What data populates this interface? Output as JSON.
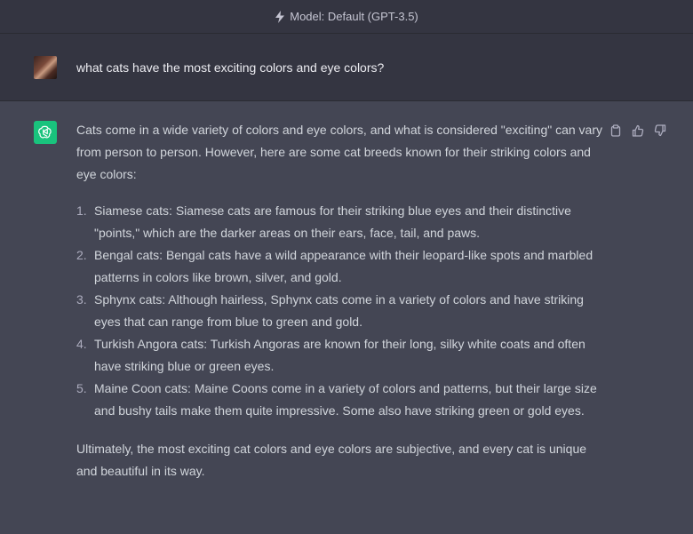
{
  "header": {
    "model_label": "Model: Default (GPT-3.5)",
    "icon": "lightning-icon"
  },
  "user_message": {
    "text": "what cats have the most exciting colors and eye colors?",
    "avatar": "user-avatar"
  },
  "assistant_message": {
    "avatar": "openai-logo-icon",
    "intro": "Cats come in a wide variety of colors and eye colors, and what is considered \"exciting\" can vary from person to person. However, here are some cat breeds known for their striking colors and eye colors:",
    "items": [
      {
        "num": "1.",
        "text": "Siamese cats: Siamese cats are famous for their striking blue eyes and their distinctive \"points,\" which are the darker areas on their ears, face, tail, and paws."
      },
      {
        "num": "2.",
        "text": "Bengal cats: Bengal cats have a wild appearance with their leopard-like spots and marbled patterns in colors like brown, silver, and gold."
      },
      {
        "num": "3.",
        "text": "Sphynx cats: Although hairless, Sphynx cats come in a variety of colors and have striking eyes that can range from blue to green and gold."
      },
      {
        "num": "4.",
        "text": "Turkish Angora cats: Turkish Angoras are known for their long, silky white coats and often have striking blue or green eyes."
      },
      {
        "num": "5.",
        "text": "Maine Coon cats: Maine Coons come in a variety of colors and patterns, but their large size and bushy tails make them quite impressive. Some also have striking green or gold eyes."
      }
    ],
    "conclusion": "Ultimately, the most exciting cat colors and eye colors are subjective, and every cat is unique and beautiful in its way.",
    "actions": [
      "copy-icon",
      "thumbs-up-icon",
      "thumbs-down-icon"
    ]
  },
  "colors": {
    "header_bg": "#343541",
    "assistant_bg": "#444654",
    "brand_green": "#19c37d",
    "text": "#d1d5db"
  }
}
